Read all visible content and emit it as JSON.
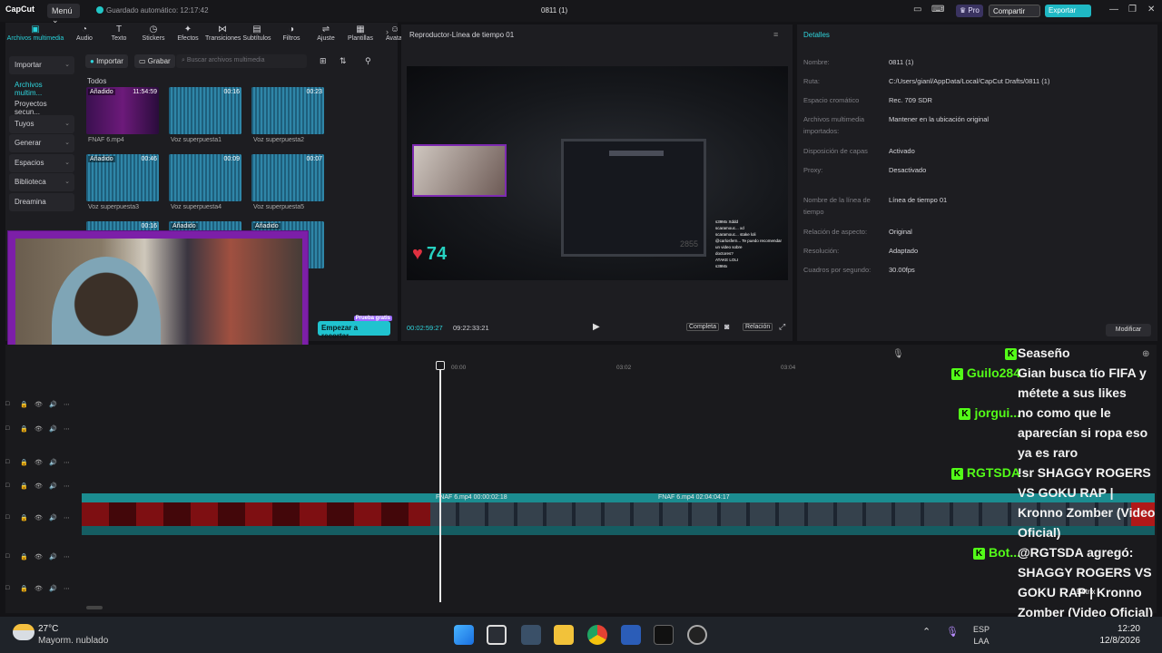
{
  "titlebar": {
    "logo": "CapCut",
    "menu": "Menú ⌄",
    "autosave": "Guardado automático: 12:17:42",
    "title": "0811 (1)",
    "pro": "♛ Pro",
    "share": "Compartir",
    "export": "Exportar",
    "minimize": "—",
    "maximize": "❐",
    "close": "✕"
  },
  "toolbar": [
    {
      "label": "Archivos multimedia",
      "icon": "▣",
      "active": true
    },
    {
      "label": "Audio",
      "icon": "◔"
    },
    {
      "label": "Texto",
      "icon": "T"
    },
    {
      "label": "Stickers",
      "icon": "◷"
    },
    {
      "label": "Efectos",
      "icon": "✦"
    },
    {
      "label": "Transiciones",
      "icon": "⋈"
    },
    {
      "label": "Subtítulos",
      "icon": "▤"
    },
    {
      "label": "Filtros",
      "icon": "◑"
    },
    {
      "label": "Ajuste",
      "icon": "⇌"
    },
    {
      "label": "Plantillas",
      "icon": "▦"
    },
    {
      "label": "Avatar",
      "icon": "☺"
    }
  ],
  "leftnav": {
    "importar": "Importar",
    "archivos": "Archivos multim...",
    "proyectos": "Proyectos secun...",
    "tuyos": "Tuyos",
    "generar": "Generar",
    "espacios": "Espacios",
    "biblioteca": "Biblioteca",
    "dreamina": "Dreamina"
  },
  "media": {
    "importar": "Importar",
    "grabar": "Grabar",
    "search_placeholder": "Buscar archivos multimedia",
    "todos": "Todos",
    "trim": "Empezar a recortar",
    "trim_badge": "Prueba gratis"
  },
  "thumbs": [
    {
      "name": "FNAF 6.mp4",
      "tag": "Añadido",
      "dur": "11:54:59"
    },
    {
      "name": "Voz superpuesta1",
      "tag": "",
      "dur": "00:16"
    },
    {
      "name": "Voz superpuesta2",
      "tag": "",
      "dur": "00:23"
    },
    {
      "name": "Voz superpuesta3",
      "tag": "Añadido",
      "dur": "00:46"
    },
    {
      "name": "Voz superpuesta4",
      "tag": "",
      "dur": "00:09"
    },
    {
      "name": "Voz superpuesta5",
      "tag": "",
      "dur": "00:07"
    },
    {
      "name": "",
      "tag": "",
      "dur": "00:16"
    },
    {
      "name": "",
      "tag": "Añadido",
      "dur": ""
    },
    {
      "name": "",
      "tag": "Añadido",
      "dur": ""
    }
  ],
  "player": {
    "title": "Reproductor-Línea de tiempo 01",
    "timecode": "00:02:59:27",
    "total": "09:22:33:21",
    "completa": "Completa",
    "relacion": "Relación",
    "health": "74",
    "monitor_value": "2855"
  },
  "stream_chat_mini": [
    "s39Mx Xddd",
    "scaramouc... xd",
    "scaramouc... stake loli",
    "@carlosfern... Te puedo recomendar",
    "un video sobre",
    "doctores?",
    "ATAKE LOLI",
    "s39Mx"
  ],
  "details": {
    "title": "Detalles",
    "rows": [
      {
        "label": "Nombre:",
        "value": "0811 (1)"
      },
      {
        "label": "Ruta:",
        "value": "C:/Users/gianl/AppData/Local/CapCut Drafts/0811 (1)"
      },
      {
        "label": "Espacio cromático",
        "value": "Rec. 709 SDR"
      },
      {
        "label": "Archivos multimedia importados:",
        "value": "Mantener en la ubicación original"
      },
      {
        "label": "Disposición de capas",
        "value": "Activado"
      },
      {
        "label": "Proxy:",
        "value": "Desactivado"
      },
      {
        "label": "Nombre de la línea de tiempo",
        "value": "Línea de tiempo 01"
      },
      {
        "label": "Relación de aspecto:",
        "value": "Original"
      },
      {
        "label": "Resolución:",
        "value": "Adaptado"
      },
      {
        "label": "Cuadros por segundo:",
        "value": "30.00fps"
      }
    ],
    "modificar": "Modificar"
  },
  "timeline": {
    "ruler": [
      "00:00",
      "03:02",
      "03:04"
    ],
    "clip1": "FNAF 6.mp4   00:00:02:18",
    "clip2": "FNAF 6.mp4   02:04:04:17"
  },
  "chat": [
    {
      "user": "",
      "msg": "Seaseño"
    },
    {
      "user": "Guilo284",
      "msg": "Gian busca tío FIFA y métete a sus likes"
    },
    {
      "user": "jorgui...",
      "msg": "no como que le aparecían si ropa eso ya es raro"
    },
    {
      "user": "RGTSDA",
      "msg": "!sr SHAGGY ROGERS VS GOKU RAP | Kronno Zomber (Video Oficial)"
    },
    {
      "user": "Bot...",
      "msg": "@RGTSDA agregó: SHAGGY ROGERS VS GOKU RAP | Kronno Zomber (Video Oficial) a la playlist"
    }
  ],
  "overlay_label": "Botrix",
  "taskbar": {
    "temp": "27°C",
    "weather": "Mayorm. nublado",
    "lang1": "ESP",
    "lang2": "LAA",
    "time": "12:20",
    "date": "12/8/2026"
  }
}
